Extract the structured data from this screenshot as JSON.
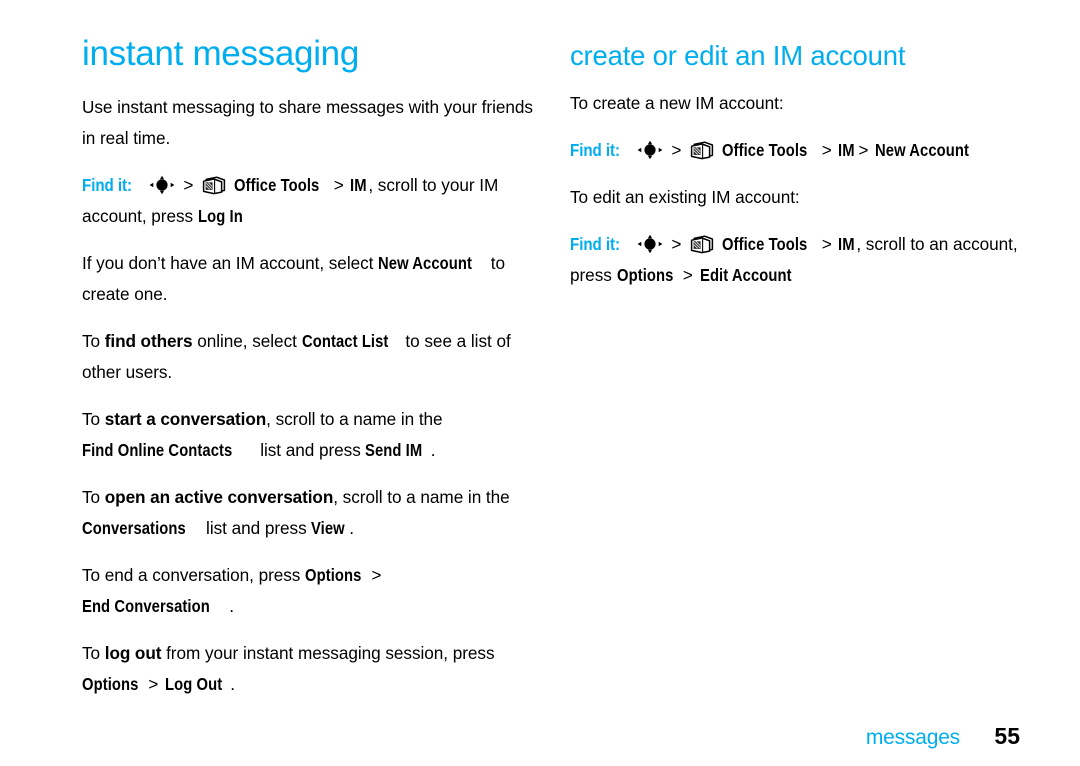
{
  "colors": {
    "accent": "#00AEEF",
    "text": "#000000",
    "background": "#FFFFFF"
  },
  "left_column": {
    "heading": "instant messaging",
    "paragraphs": [
      {
        "id": "intro",
        "runs": [
          {
            "t": "Use instant messaging to share messages with your friends in real time.",
            "s": "plain"
          }
        ]
      },
      {
        "id": "find-it-login",
        "runs": [
          {
            "t": "Find it:",
            "s": "findit"
          },
          {
            "t": "nav-key-icon",
            "s": "icon-nav"
          },
          {
            "t": ">",
            "s": "gt"
          },
          {
            "t": "office-tools-icon",
            "s": "icon-tools"
          },
          {
            "t": "Office Tools",
            "s": "ui"
          },
          {
            "t": ">",
            "s": "gt"
          },
          {
            "t": "IM",
            "s": "ui"
          },
          {
            "t": ", scroll to your IM account, press ",
            "s": "plain"
          },
          {
            "t": "Log In",
            "s": "ui"
          }
        ]
      },
      {
        "id": "new-account",
        "runs": [
          {
            "t": "If you don’t have an IM account, select ",
            "s": "plain"
          },
          {
            "t": "New Account",
            "s": "ui"
          },
          {
            "t": " to create one.",
            "s": "plain"
          }
        ]
      },
      {
        "id": "find-others",
        "runs": [
          {
            "t": "To ",
            "s": "plain"
          },
          {
            "t": "find others",
            "s": "em"
          },
          {
            "t": " online, select ",
            "s": "plain"
          },
          {
            "t": "Contact List",
            "s": "ui"
          },
          {
            "t": " to see a list of other users.",
            "s": "plain"
          }
        ]
      },
      {
        "id": "start-conversation",
        "runs": [
          {
            "t": "To ",
            "s": "plain"
          },
          {
            "t": "start a conversation",
            "s": "em"
          },
          {
            "t": ", scroll to a name in the ",
            "s": "plain"
          },
          {
            "t": "Find Online Contacts",
            "s": "ui"
          },
          {
            "t": " list and press ",
            "s": "plain"
          },
          {
            "t": "Send IM",
            "s": "ui"
          },
          {
            "t": ".",
            "s": "plain"
          }
        ]
      },
      {
        "id": "open-conversation",
        "runs": [
          {
            "t": "To ",
            "s": "plain"
          },
          {
            "t": "open an active conversation",
            "s": "em"
          },
          {
            "t": ", scroll to a name in the ",
            "s": "plain"
          },
          {
            "t": "Conversations",
            "s": "ui"
          },
          {
            "t": " list and press ",
            "s": "plain"
          },
          {
            "t": "View",
            "s": "ui"
          },
          {
            "t": ".",
            "s": "plain"
          }
        ]
      },
      {
        "id": "end-conversation",
        "runs": [
          {
            "t": "To end a conversation, press ",
            "s": "plain"
          },
          {
            "t": "Options",
            "s": "ui"
          },
          {
            "t": ">",
            "s": "gt"
          },
          {
            "t": "End Conversation",
            "s": "ui"
          },
          {
            "t": ".",
            "s": "plain"
          }
        ]
      },
      {
        "id": "log-out",
        "runs": [
          {
            "t": "To ",
            "s": "plain"
          },
          {
            "t": "log out",
            "s": "em"
          },
          {
            "t": " from your instant messaging session, press ",
            "s": "plain"
          },
          {
            "t": "Options",
            "s": "ui"
          },
          {
            "t": ">",
            "s": "gt"
          },
          {
            "t": "Log Out",
            "s": "ui"
          },
          {
            "t": ".",
            "s": "plain"
          }
        ]
      }
    ]
  },
  "right_column": {
    "heading": "create or edit an IM account",
    "paragraphs": [
      {
        "id": "create-intro",
        "runs": [
          {
            "t": "To create a new IM account:",
            "s": "plain"
          }
        ]
      },
      {
        "id": "find-it-new-account",
        "runs": [
          {
            "t": "Find it:",
            "s": "findit"
          },
          {
            "t": "nav-key-icon",
            "s": "icon-nav"
          },
          {
            "t": ">",
            "s": "gt"
          },
          {
            "t": "office-tools-icon",
            "s": "icon-tools"
          },
          {
            "t": "Office Tools",
            "s": "ui"
          },
          {
            "t": ">",
            "s": "gt"
          },
          {
            "t": "IM",
            "s": "ui"
          },
          {
            "t": ">",
            "s": "gt"
          },
          {
            "t": "New Account",
            "s": "ui"
          }
        ]
      },
      {
        "id": "edit-intro",
        "runs": [
          {
            "t": "To edit an existing IM account:",
            "s": "plain"
          }
        ]
      },
      {
        "id": "find-it-edit-account",
        "runs": [
          {
            "t": "Find it:",
            "s": "findit"
          },
          {
            "t": "nav-key-icon",
            "s": "icon-nav"
          },
          {
            "t": ">",
            "s": "gt"
          },
          {
            "t": "office-tools-icon",
            "s": "icon-tools"
          },
          {
            "t": "Office Tools",
            "s": "ui"
          },
          {
            "t": ">",
            "s": "gt"
          },
          {
            "t": "IM",
            "s": "ui"
          },
          {
            "t": ", scroll to an account, press ",
            "s": "plain"
          },
          {
            "t": "Options",
            "s": "ui"
          },
          {
            "t": ">",
            "s": "gt"
          },
          {
            "t": "Edit Account",
            "s": "ui"
          }
        ]
      }
    ]
  },
  "footer": {
    "chapter": "messages",
    "page_number": "55"
  }
}
